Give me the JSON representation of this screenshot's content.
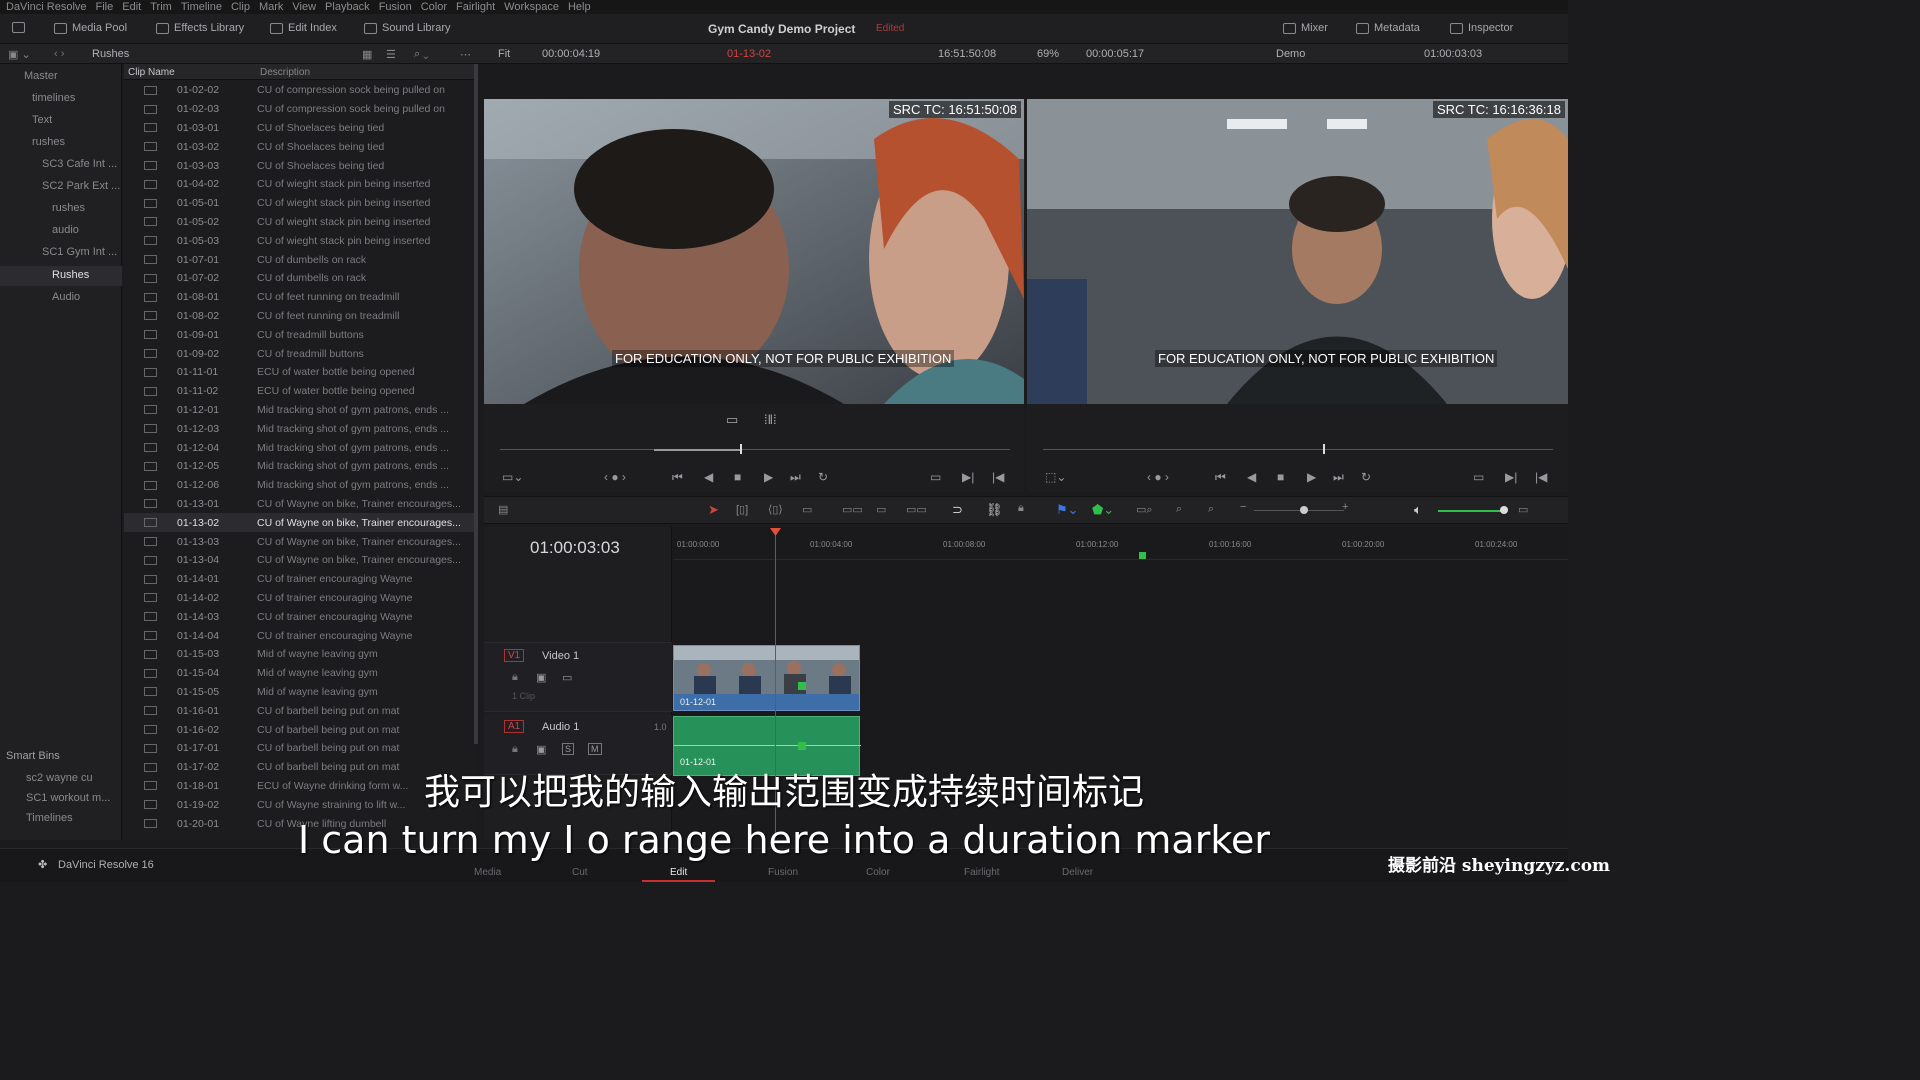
{
  "menu": [
    "DaVinci Resolve",
    "File",
    "Edit",
    "Trim",
    "Timeline",
    "Clip",
    "Mark",
    "View",
    "Playback",
    "Fusion",
    "Color",
    "Fairlight",
    "Workspace",
    "Help"
  ],
  "toolbar": {
    "media_pool": "Media Pool",
    "effects": "Effects Library",
    "edit_index": "Edit Index",
    "sound": "Sound Library",
    "project": "Gym Candy Demo Project",
    "edited": "Edited",
    "mixer": "Mixer",
    "metadata": "Metadata",
    "inspector": "Inspector"
  },
  "subbar": {
    "bin_title": "Rushes",
    "fit": "Fit",
    "src_duration": "00:00:04:19",
    "clip_name": "01-13-02",
    "src_tc": "16:51:50:08",
    "zoom": "69%",
    "tl_duration": "00:00:05:17",
    "timeline_name": "Demo",
    "tl_tc": "01:00:03:03"
  },
  "bins": {
    "master": "Master",
    "timelines": "timelines",
    "text": "Text",
    "rushes": "rushes",
    "sc3": "SC3 Cafe Int ...",
    "sc2": "SC2 Park Ext ...",
    "sc2_rushes": "rushes",
    "sc2_audio": "audio",
    "sc1": "SC1 Gym Int ...",
    "sc1_rushes": "Rushes",
    "sc1_audio": "Audio",
    "smart_bins": "Smart Bins",
    "smart1": "sc2 wayne cu",
    "smart2": "SC1 workout m...",
    "smart3": "Timelines"
  },
  "columns": {
    "clip_name": "Clip Name",
    "description": "Description"
  },
  "clips": [
    {
      "n": "01-02-02",
      "d": "CU of compression sock being pulled on"
    },
    {
      "n": "01-02-03",
      "d": "CU of compression sock being pulled on"
    },
    {
      "n": "01-03-01",
      "d": "CU of Shoelaces being tied"
    },
    {
      "n": "01-03-02",
      "d": "CU of Shoelaces being tied"
    },
    {
      "n": "01-03-03",
      "d": "CU of Shoelaces being tied"
    },
    {
      "n": "01-04-02",
      "d": "CU of wieght stack pin being inserted"
    },
    {
      "n": "01-05-01",
      "d": "CU of wieght stack pin being inserted"
    },
    {
      "n": "01-05-02",
      "d": "CU of wieght stack pin being inserted"
    },
    {
      "n": "01-05-03",
      "d": "CU of wieght stack pin being inserted"
    },
    {
      "n": "01-07-01",
      "d": "CU of dumbells on rack"
    },
    {
      "n": "01-07-02",
      "d": "CU of dumbells on rack"
    },
    {
      "n": "01-08-01",
      "d": "CU of feet running on treadmill"
    },
    {
      "n": "01-08-02",
      "d": "CU of feet running on treadmill"
    },
    {
      "n": "01-09-01",
      "d": "CU of treadmill buttons"
    },
    {
      "n": "01-09-02",
      "d": "CU of treadmill buttons"
    },
    {
      "n": "01-11-01",
      "d": "ECU of water bottle being opened"
    },
    {
      "n": "01-11-02",
      "d": "ECU of water bottle being opened"
    },
    {
      "n": "01-12-01",
      "d": "Mid tracking shot of gym patrons, ends ..."
    },
    {
      "n": "01-12-03",
      "d": "Mid tracking shot of gym patrons, ends ..."
    },
    {
      "n": "01-12-04",
      "d": "Mid tracking shot of gym patrons, ends ..."
    },
    {
      "n": "01-12-05",
      "d": "Mid tracking shot of gym patrons, ends ..."
    },
    {
      "n": "01-12-06",
      "d": "Mid tracking shot of gym patrons, ends ..."
    },
    {
      "n": "01-13-01",
      "d": "CU of Wayne on bike, Trainer encourages..."
    },
    {
      "n": "01-13-02",
      "d": "CU of Wayne on bike, Trainer encourages..."
    },
    {
      "n": "01-13-03",
      "d": "CU of Wayne on bike, Trainer encourages..."
    },
    {
      "n": "01-13-04",
      "d": "CU of Wayne on bike, Trainer encourages..."
    },
    {
      "n": "01-14-01",
      "d": "CU of trainer encouraging Wayne"
    },
    {
      "n": "01-14-02",
      "d": "CU of trainer encouraging Wayne"
    },
    {
      "n": "01-14-03",
      "d": "CU of trainer encouraging Wayne"
    },
    {
      "n": "01-14-04",
      "d": "CU of trainer encouraging Wayne"
    },
    {
      "n": "01-15-03",
      "d": "Mid of wayne leaving gym"
    },
    {
      "n": "01-15-04",
      "d": "Mid of wayne leaving gym"
    },
    {
      "n": "01-15-05",
      "d": "Mid of wayne leaving gym"
    },
    {
      "n": "01-16-01",
      "d": "CU of barbell being put on mat"
    },
    {
      "n": "01-16-02",
      "d": "CU of barbell being put on mat"
    },
    {
      "n": "01-17-01",
      "d": "CU of barbell being put on mat"
    },
    {
      "n": "01-17-02",
      "d": "CU of barbell being put on mat"
    },
    {
      "n": "01-18-01",
      "d": "ECU of Wayne drinking form w..."
    },
    {
      "n": "01-19-02",
      "d": "CU of Wayne straining to lift w..."
    },
    {
      "n": "01-20-01",
      "d": "CU of Wayne lifting dumbell"
    }
  ],
  "selected_clip": "01-13-02",
  "viewer": {
    "src_tc_label": "SRC TC: 16:51:50:08",
    "tl_tc_label": "SRC TC: 16:16:36:18",
    "watermark": "FOR EDUCATION ONLY, NOT FOR PUBLIC EXHIBITION"
  },
  "timeline": {
    "tc": "01:00:03:03",
    "ticks": [
      "01:00:00:00",
      "01:00:04:00",
      "01:00:08:00",
      "01:00:12:00",
      "01:00:16:00",
      "01:00:20:00",
      "01:00:24:00"
    ],
    "v1": "V1",
    "video_track": "Video 1",
    "clip_count": "1 Clip",
    "a1": "A1",
    "audio_track": "Audio 1",
    "audio_level": "1.0",
    "clip_label": "01-12-01"
  },
  "app_name": "DaVinci Resolve 16",
  "pages": [
    "Media",
    "Cut",
    "Edit",
    "Fusion",
    "Color",
    "Fairlight",
    "Deliver"
  ],
  "active_page": "Edit",
  "subtitle_cn": "我可以把我的输入输出范围变成持续时间标记",
  "subtitle_en": "I can turn my I o range here into a duration marker",
  "site_watermark": "摄影前沿 sheyingzyz.com",
  "colors": {
    "accent": "#c62f2f",
    "video_clip": "#3d6ea8",
    "audio_clip": "#27915a",
    "marker": "#2fbf4a"
  }
}
